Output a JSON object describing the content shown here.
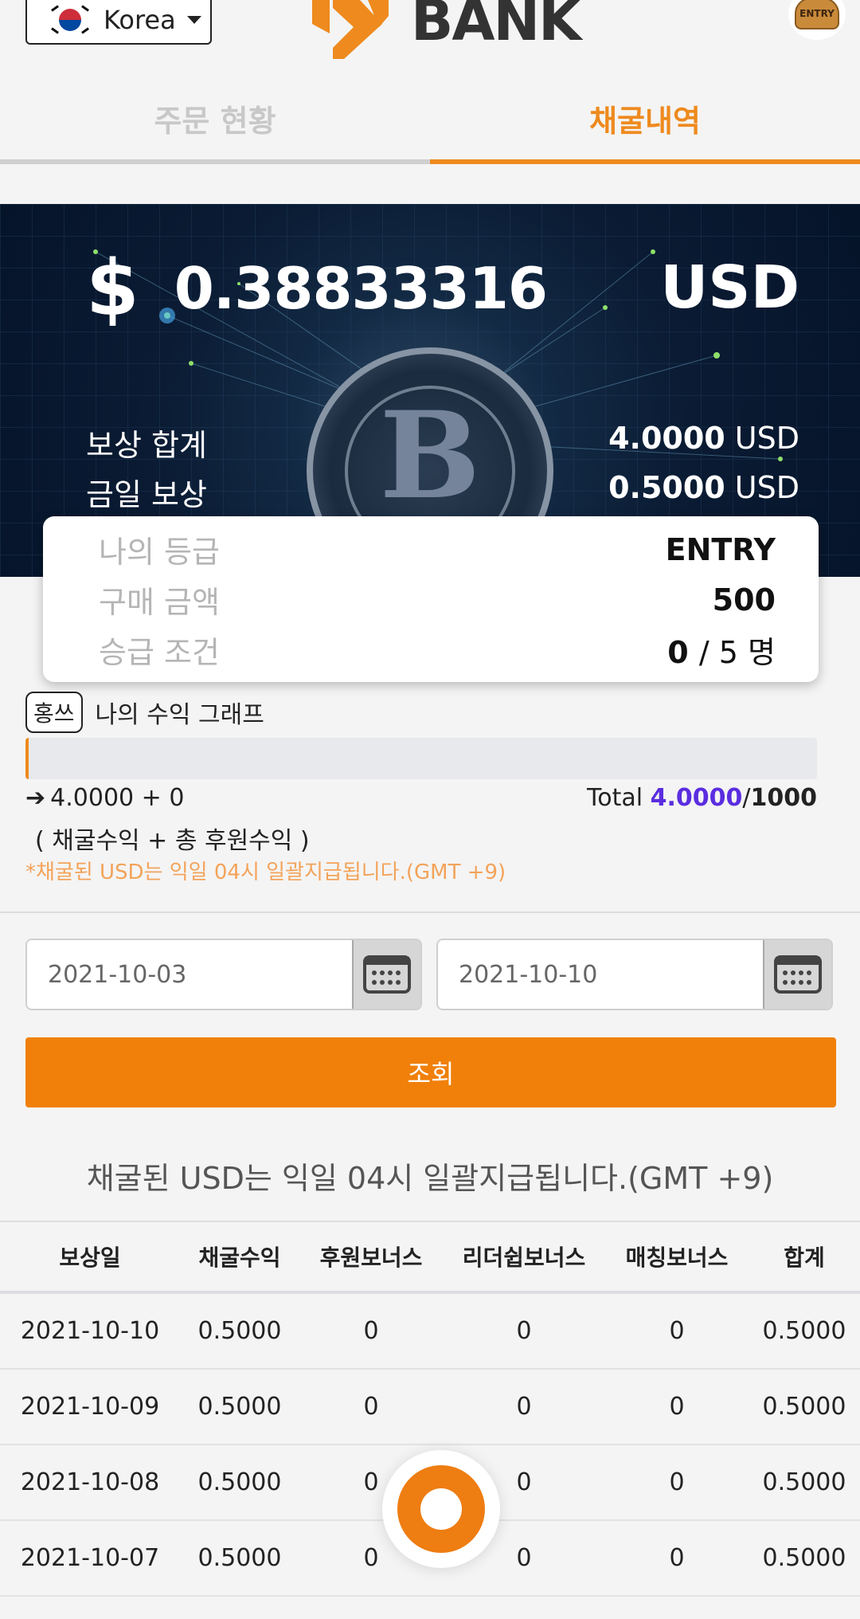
{
  "header": {
    "language": "Korea",
    "logo_text": "BANK",
    "avatar_badge": "ENTRY"
  },
  "tabs": [
    {
      "label": "주문 현황",
      "active": false
    },
    {
      "label": "채굴내역",
      "active": true
    }
  ],
  "banner": {
    "currency_symbol": "$",
    "amount": "0.38833316",
    "unit": "USD",
    "rows": [
      {
        "label": "보상 합계",
        "value": "4.0000",
        "unit": "USD"
      },
      {
        "label": "금일 보상",
        "value": "0.5000",
        "unit": "USD"
      }
    ]
  },
  "grade": {
    "rows": [
      {
        "label": "나의 등급",
        "value": "ENTRY"
      },
      {
        "label": "구매 금액",
        "value": "500"
      }
    ],
    "promotion": {
      "label": "승급 조건",
      "current": "0",
      "rest": "/ 5 명"
    }
  },
  "graph": {
    "tag": "홍쓰",
    "title": "나의 수익 그래프",
    "progress_fraction": 0.004,
    "formula": "4.0000 + 0",
    "total_label": "Total",
    "total_current": "4.0000",
    "total_sep": "/",
    "total_max": "1000",
    "subtitle": "( 채굴수익 + 총 후원수익 )",
    "note": "*채굴된 USD는 익일 04시 일괄지급됩니다.(GMT +9)"
  },
  "filter": {
    "start_date": "2021-10-03",
    "end_date": "2021-10-10",
    "search_label": "조회"
  },
  "notice": "채굴된 USD는 익일 04시 일괄지급됩니다.(GMT +9)",
  "table": {
    "headers": [
      "보상일",
      "채굴수익",
      "후원보너스",
      "리더쉽보너스",
      "매칭보너스",
      "합계"
    ],
    "rows": [
      [
        "2021-10-10",
        "0.5000",
        "0",
        "0",
        "0",
        "0.5000"
      ],
      [
        "2021-10-09",
        "0.5000",
        "0",
        "0",
        "0",
        "0.5000"
      ],
      [
        "2021-10-08",
        "0.5000",
        "0",
        "0",
        "0",
        "0.5000"
      ],
      [
        "2021-10-07",
        "0.5000",
        "0",
        "0",
        "0",
        "0.5000"
      ]
    ]
  },
  "colors": {
    "accent": "#ee8a1e",
    "button": "#f0800a",
    "total_highlight": "#5a2de0",
    "note": "#f3a35a"
  },
  "icons": {
    "flag": "korea-flag-icon",
    "caret": "caret-down-icon",
    "calendar": "calendar-icon",
    "arrow": "arrow-right-icon",
    "fab": "chat-icon"
  }
}
